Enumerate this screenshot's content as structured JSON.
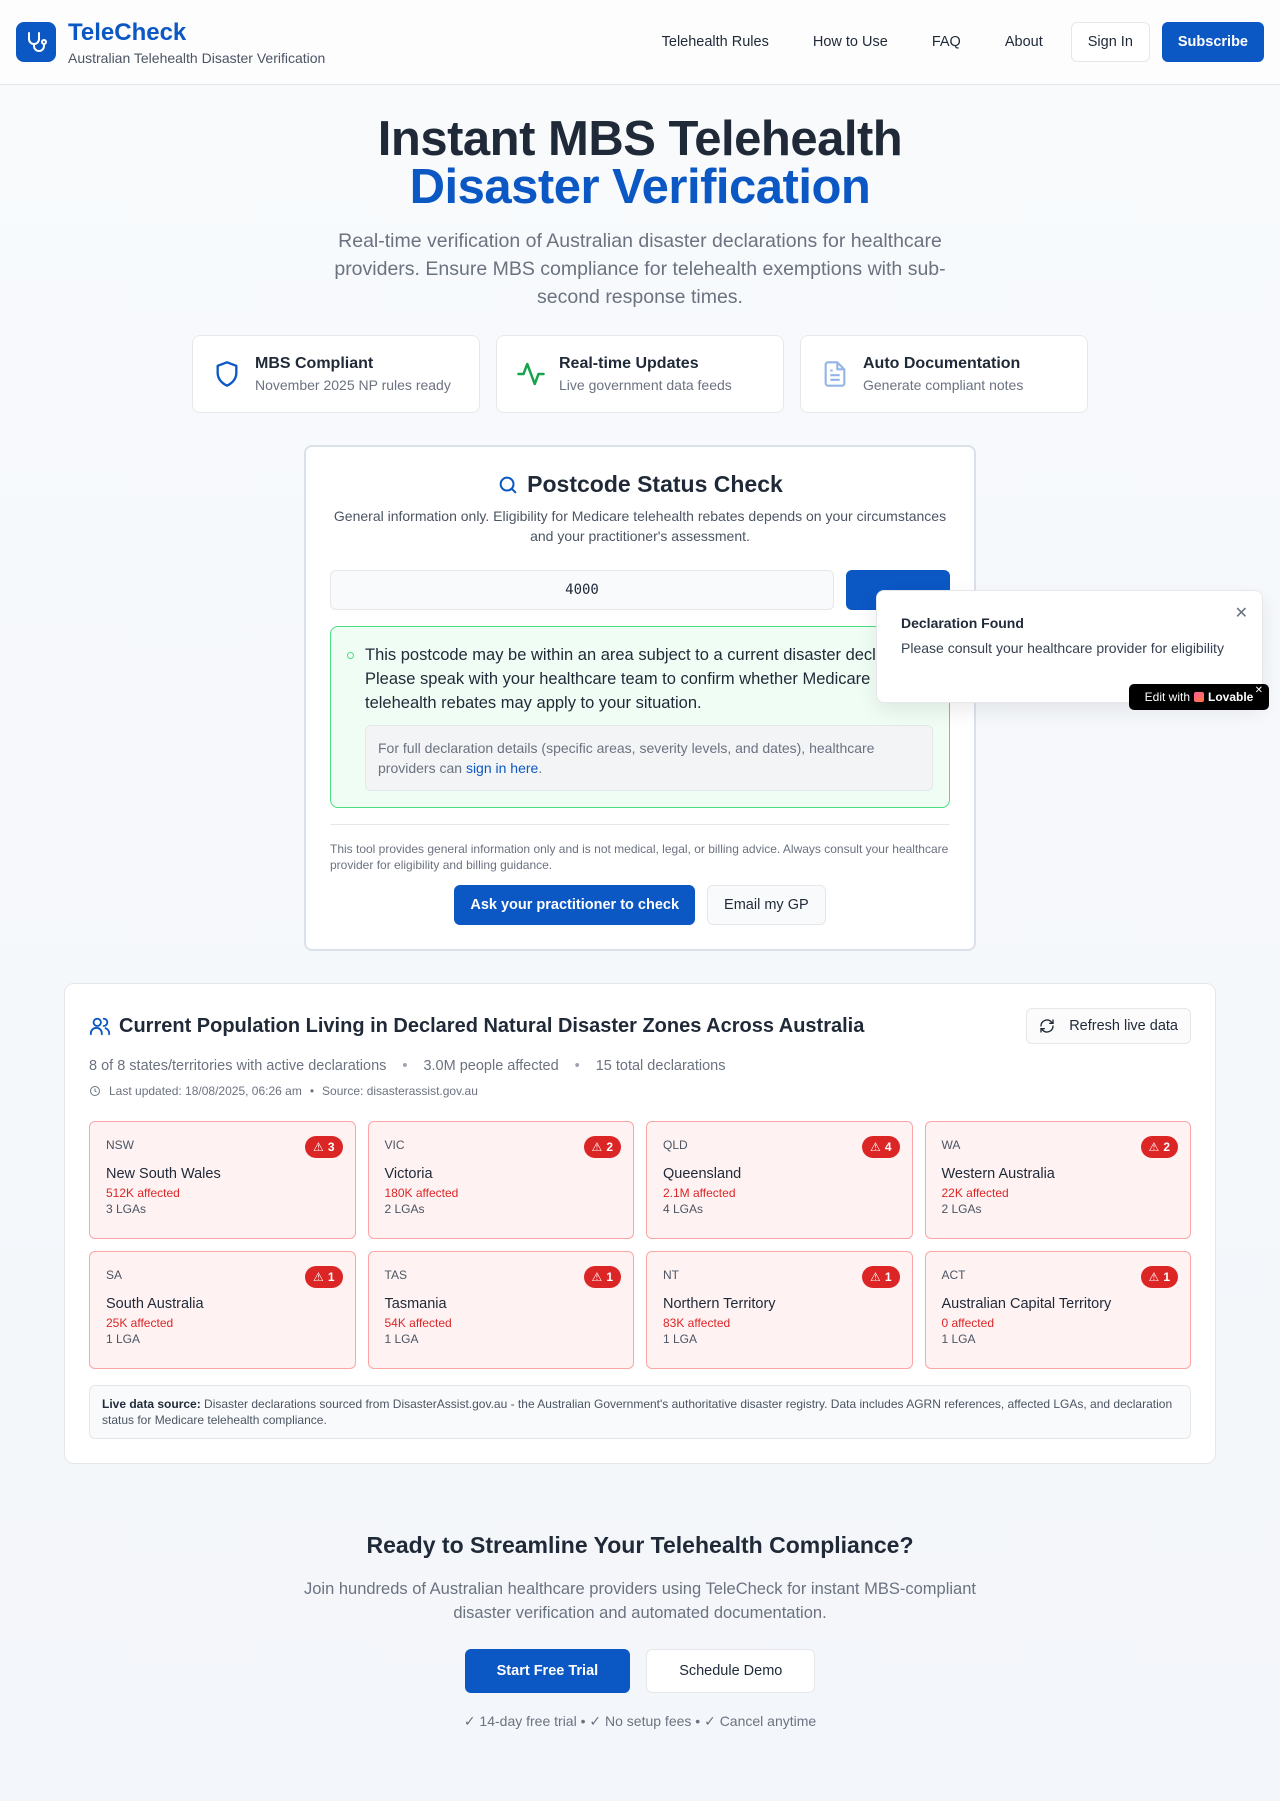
{
  "header": {
    "brand_name": "TeleCheck",
    "brand_subtitle": "Australian Telehealth Disaster Verification",
    "logo_icon": "stethoscope-icon",
    "nav": [
      "Telehealth Rules",
      "How to Use",
      "FAQ",
      "About"
    ],
    "sign_in": "Sign In",
    "subscribe": "Subscribe",
    "brand_color": "#0b57c4"
  },
  "hero": {
    "title_line1": "Instant MBS Telehealth",
    "title_line2": "Disaster Verification",
    "description": "Real-time verification of Australian disaster declarations for healthcare providers. Ensure MBS compliance for telehealth exemptions with sub-second response times."
  },
  "features": [
    {
      "icon": "shield-icon",
      "title": "MBS Compliant",
      "subtitle": "November 2025 NP rules ready"
    },
    {
      "icon": "activity-icon",
      "title": "Real-time Updates",
      "subtitle": "Live government data feeds"
    },
    {
      "icon": "document-icon",
      "title": "Auto Documentation",
      "subtitle": "Generate compliant notes"
    }
  ],
  "check": {
    "title": "Postcode Status Check",
    "description": "General information only. Eligibility for Medicare telehealth rebates depends on your circumstances and your practitioner's assessment.",
    "postcode_value": "4000",
    "result_text": "This postcode may be within an area subject to a current disaster declaration. Please speak with your healthcare team to confirm whether Medicare telehealth rebates may apply to your situation.",
    "note_prefix": "For full declaration details (specific areas, severity levels, and dates), healthcare providers can ",
    "note_link": "sign in here",
    "note_suffix": ".",
    "disclaimer": "This tool provides general information only and is not medical, legal, or billing advice. Always consult your healthcare provider for eligibility and billing guidance.",
    "ask_button": "Ask your practitioner to check",
    "email_button": "Email my GP",
    "success_color": "#4ade80"
  },
  "toast": {
    "title": "Declaration Found",
    "message": "Please consult your healthcare provider for eligibility"
  },
  "lovable": {
    "prefix": "Edit with",
    "brand": "Lovable"
  },
  "population": {
    "title": "Current Population Living in Declared Natural Disaster Zones Across Australia",
    "refresh": "Refresh live data",
    "stat_states": "8 of 8 states/territories with active declarations",
    "stat_people": "3.0M people affected",
    "stat_declarations": "15 total declarations",
    "last_updated": "Last updated: 18/08/2025, 06:26 am",
    "source": "Source: disasterassist.gov.au",
    "states": [
      {
        "code": "NSW",
        "name": "New South Wales",
        "count": "3",
        "affected": "512K affected",
        "lgas": "3 LGAs"
      },
      {
        "code": "VIC",
        "name": "Victoria",
        "count": "2",
        "affected": "180K affected",
        "lgas": "2 LGAs"
      },
      {
        "code": "QLD",
        "name": "Queensland",
        "count": "4",
        "affected": "2.1M affected",
        "lgas": "4 LGAs"
      },
      {
        "code": "WA",
        "name": "Western Australia",
        "count": "2",
        "affected": "22K affected",
        "lgas": "2 LGAs"
      },
      {
        "code": "SA",
        "name": "South Australia",
        "count": "1",
        "affected": "25K affected",
        "lgas": "1 LGA"
      },
      {
        "code": "TAS",
        "name": "Tasmania",
        "count": "1",
        "affected": "54K affected",
        "lgas": "1 LGA"
      },
      {
        "code": "NT",
        "name": "Northern Territory",
        "count": "1",
        "affected": "83K affected",
        "lgas": "1 LGA"
      },
      {
        "code": "ACT",
        "name": "Australian Capital Territory",
        "count": "1",
        "affected": "0 affected",
        "lgas": "1 LGA"
      }
    ],
    "source_label": "Live data source:",
    "source_text": " Disaster declarations sourced from DisasterAssist.gov.au - the Australian Government's authoritative disaster registry. Data includes AGRN references, affected LGAs, and declaration status for Medicare telehealth compliance.",
    "alert_color": "#dc2626"
  },
  "cta": {
    "title": "Ready to Streamline Your Telehealth Compliance?",
    "description": "Join hundreds of Australian healthcare providers using TeleCheck for instant MBS-compliant disaster verification and automated documentation.",
    "start": "Start Free Trial",
    "demo": "Schedule Demo",
    "note": "✓ 14-day free trial • ✓ No setup fees • ✓ Cancel anytime"
  }
}
